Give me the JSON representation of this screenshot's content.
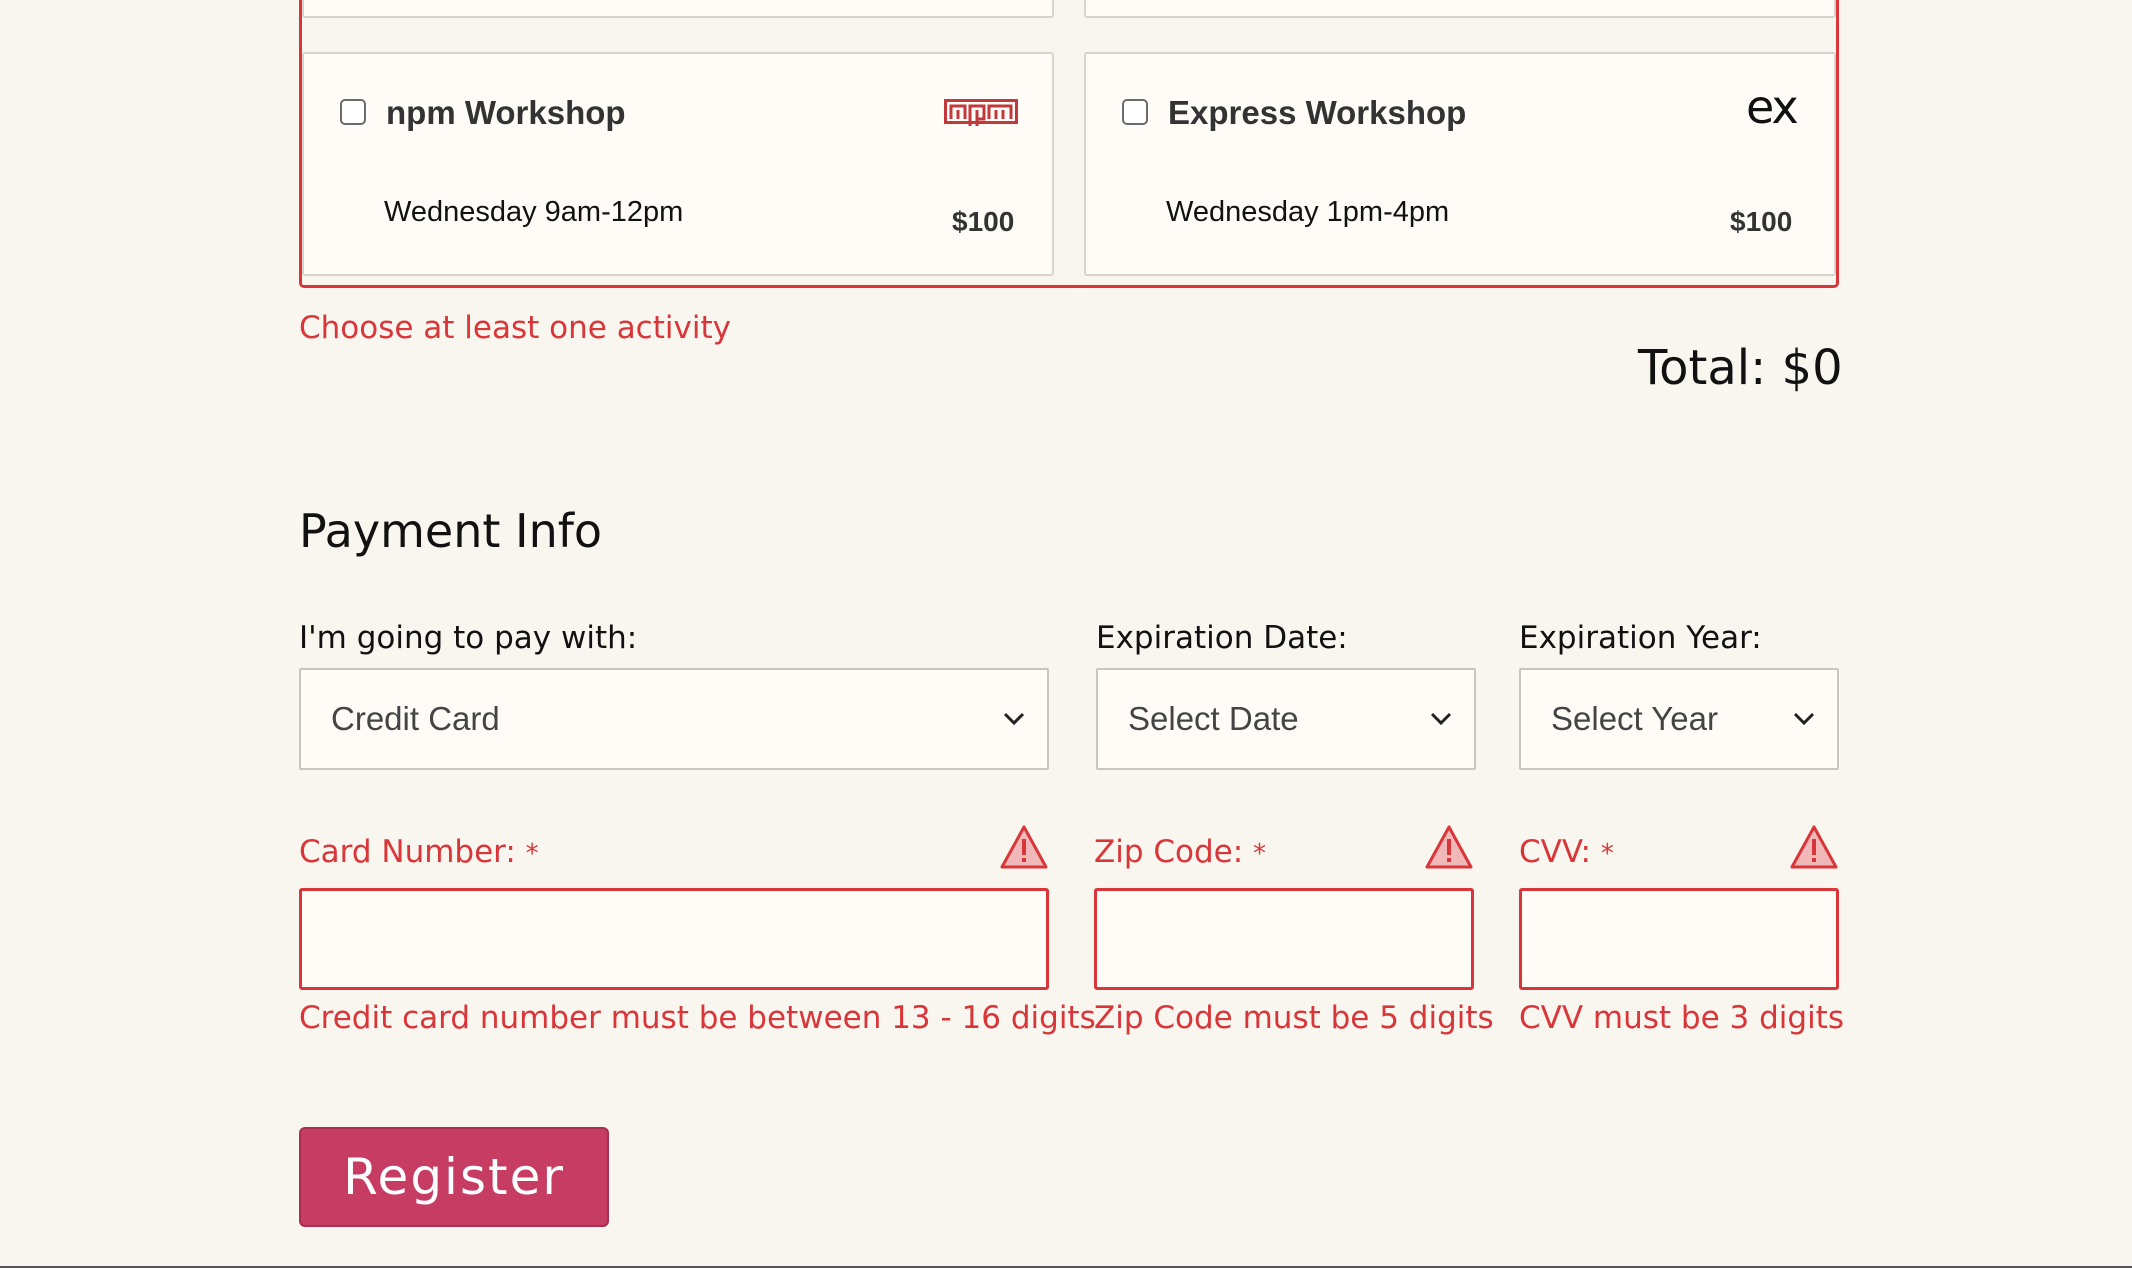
{
  "activities": [
    {
      "title": "npm Workshop",
      "time": "Wednesday 9am-12pm",
      "price": "$100",
      "checked": false,
      "logo_text": "npm",
      "logo_icon": "npm-logo-icon"
    },
    {
      "title": "Express Workshop",
      "time": "Wednesday 1pm-4pm",
      "price": "$100",
      "checked": false,
      "logo_text": "ex",
      "logo_icon": "express-logo-icon"
    }
  ],
  "activities_error": "Choose at least one activity",
  "total": "Total: $0",
  "payment": {
    "section_title": "Payment Info",
    "method_label": "I'm going to pay with:",
    "method_value": "Credit Card",
    "exp_date_label": "Expiration Date:",
    "exp_date_value": "Select Date",
    "exp_year_label": "Expiration Year:",
    "exp_year_value": "Select Year",
    "card_number_label": "Card Number:",
    "card_number_error": "Credit card number must be between 13 - 16 digits",
    "zip_label": "Zip Code:",
    "zip_error": "Zip Code must be 5 digits",
    "cvv_label": "CVV:",
    "cvv_error": "CVV must be 3 digits",
    "required_marker": "*"
  },
  "register_label": "Register",
  "colors": {
    "error": "#d9363a",
    "button": "#c73c63",
    "background": "#f9f5ef",
    "card": "#fffcf8"
  }
}
